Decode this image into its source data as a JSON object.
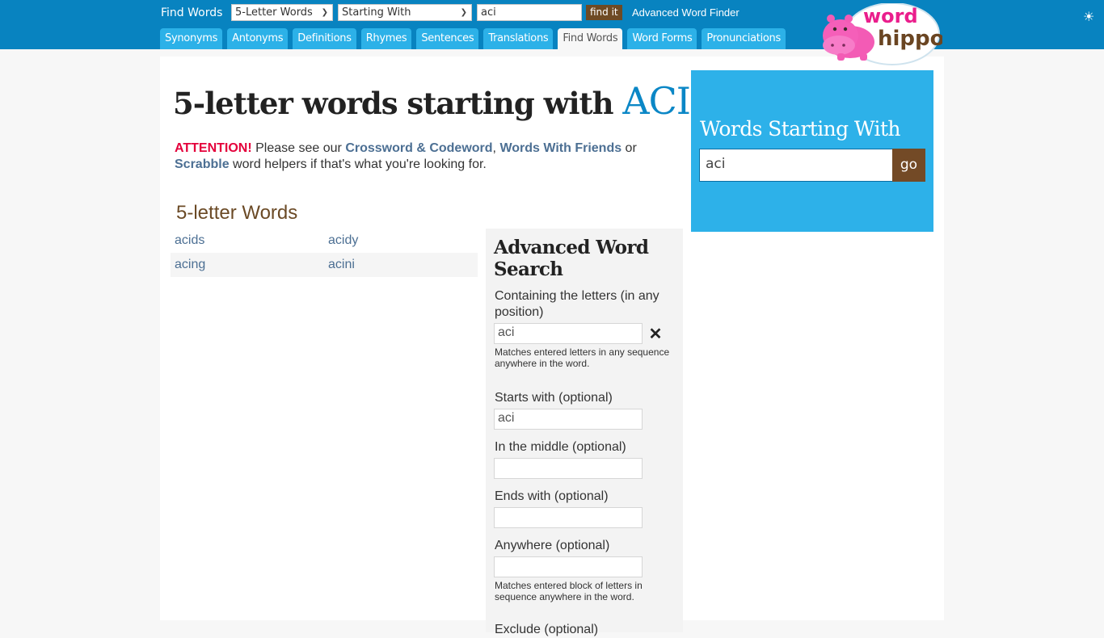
{
  "header": {
    "label": "Find Words",
    "type_select": "5-Letter Words",
    "mode_select": "Starting With",
    "search_value": "aci",
    "find_button": "find it",
    "advanced_link": "Advanced Word Finder",
    "tabs": [
      {
        "label": "Synonyms",
        "active": false
      },
      {
        "label": "Antonyms",
        "active": false
      },
      {
        "label": "Definitions",
        "active": false
      },
      {
        "label": "Rhymes",
        "active": false
      },
      {
        "label": "Sentences",
        "active": false
      },
      {
        "label": "Translations",
        "active": false
      },
      {
        "label": "Find Words",
        "active": true
      },
      {
        "label": "Word Forms",
        "active": false
      },
      {
        "label": "Pronunciations",
        "active": false
      }
    ],
    "logo": {
      "line1": "word",
      "line2": "hippo"
    },
    "theme_icon": "sun-icon"
  },
  "main": {
    "title_prefix": "5-letter words starting with ",
    "title_accent": "ACI",
    "attention": {
      "warn": "ATTENTION!",
      "text1": " Please see our ",
      "link1": "Crossword & Codeword",
      "sep": ", ",
      "link2": "Words With Friends",
      "text2": " or ",
      "link3": "Scrabble",
      "text3": " word helpers if that's what you're looking for."
    },
    "section_title": "5-letter Words",
    "words": [
      [
        "acids",
        "acidy"
      ],
      [
        "acing",
        "acini"
      ]
    ]
  },
  "advanced": {
    "title": "Advanced Word Search",
    "containing_label": "Containing the letters (in any position)",
    "containing_value": "aci",
    "containing_help": "Matches entered letters in any sequence anywhere in the word.",
    "starts_label": "Starts with (optional)",
    "starts_value": "aci",
    "middle_label": "In the middle (optional)",
    "middle_value": "",
    "ends_label": "Ends with (optional)",
    "ends_value": "",
    "anywhere_label": "Anywhere (optional)",
    "anywhere_value": "",
    "anywhere_help": "Matches entered block of letters in sequence anywhere in the word.",
    "exclude_label": "Exclude (optional)"
  },
  "widget": {
    "title": "Words Starting With",
    "input_value": "aci",
    "go_label": "go"
  },
  "colors": {
    "header_bg": "#0883c0",
    "tab_bg": "#2cb1e8",
    "accent_blue": "#0b87c6",
    "brand_brown": "#6e4a24",
    "warn_red": "#e4003b",
    "link": "#4c6f93"
  }
}
